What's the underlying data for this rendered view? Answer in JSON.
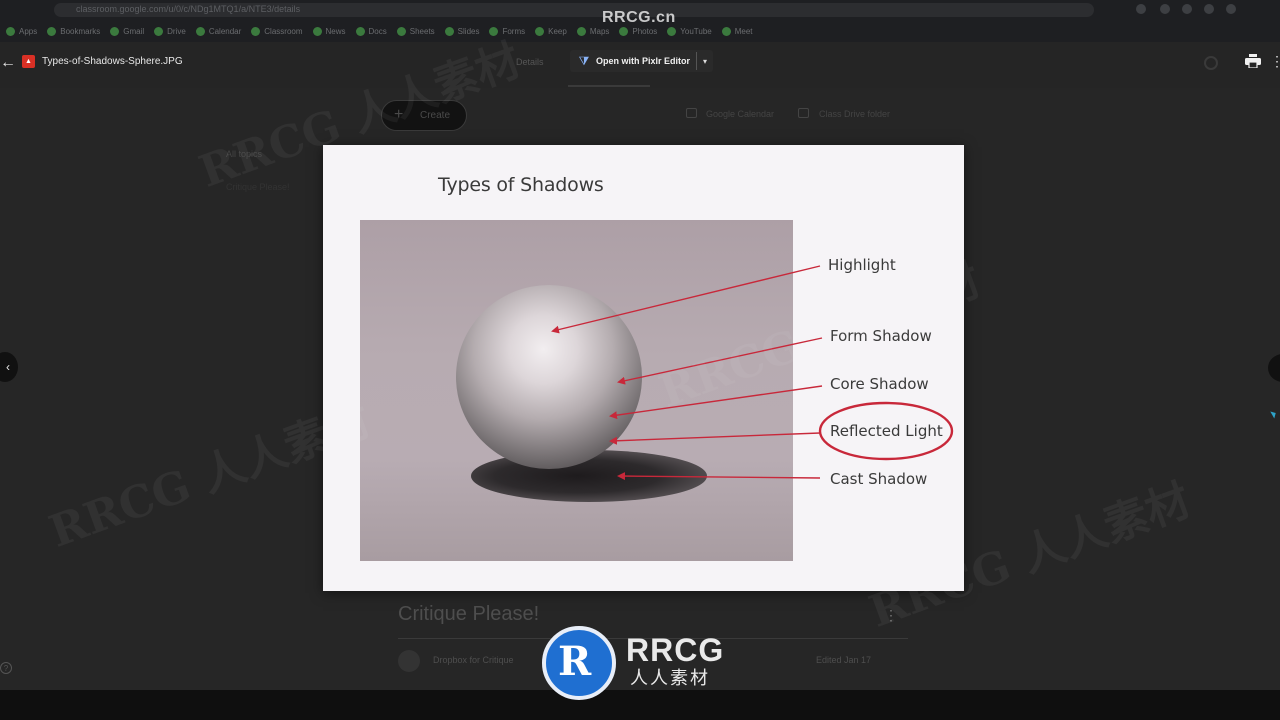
{
  "browser": {
    "url": "classroom.google.com/u/0/c/NDg1MTQ1/a/NTE3/details",
    "bookmarks": [
      "Apps",
      "Bookmarks",
      "Gmail",
      "Drive",
      "Calendar",
      "Classroom",
      "News",
      "Docs",
      "Sheets",
      "Slides",
      "Forms",
      "Keep",
      "Maps",
      "Photos",
      "YouTube",
      "Meet"
    ]
  },
  "viewer": {
    "back_glyph": "←",
    "file_icon_glyph": "▲",
    "file_name": "Types-of-Shadows-Sphere.JPG",
    "tab_left": "Details",
    "open_with_glyph": "⧩",
    "open_with_label": "Open with Pixlr Editor",
    "open_with_caret": "▾",
    "more_glyph": "⋮"
  },
  "background_page": {
    "create_plus": "+",
    "create_label": "Create",
    "calendar_link": "Google Calendar",
    "drive_link": "Class Drive folder",
    "topics_all": "All topics",
    "topics_sub": "Critique Please!",
    "assignment_title": "Critique Please!",
    "kebab": "⋮",
    "dropbox_label": "Dropbox for Critique",
    "due_label": "Edited Jan 17",
    "help_glyph": "?"
  },
  "nav": {
    "prev_glyph": "‹"
  },
  "slide": {
    "title": "Types of Shadows",
    "labels": {
      "highlight": "Highlight",
      "form_shadow": "Form Shadow",
      "core_shadow": "Core Shadow",
      "reflected_light": "Reflected Light",
      "cast_shadow": "Cast Shadow"
    },
    "arrow_color": "#c8283a"
  },
  "watermark": {
    "top": "RRCG.cn",
    "faint": "RRCG 人人素材",
    "logo_letter": "R",
    "brand": "RRCG",
    "sub": "人人素材"
  }
}
